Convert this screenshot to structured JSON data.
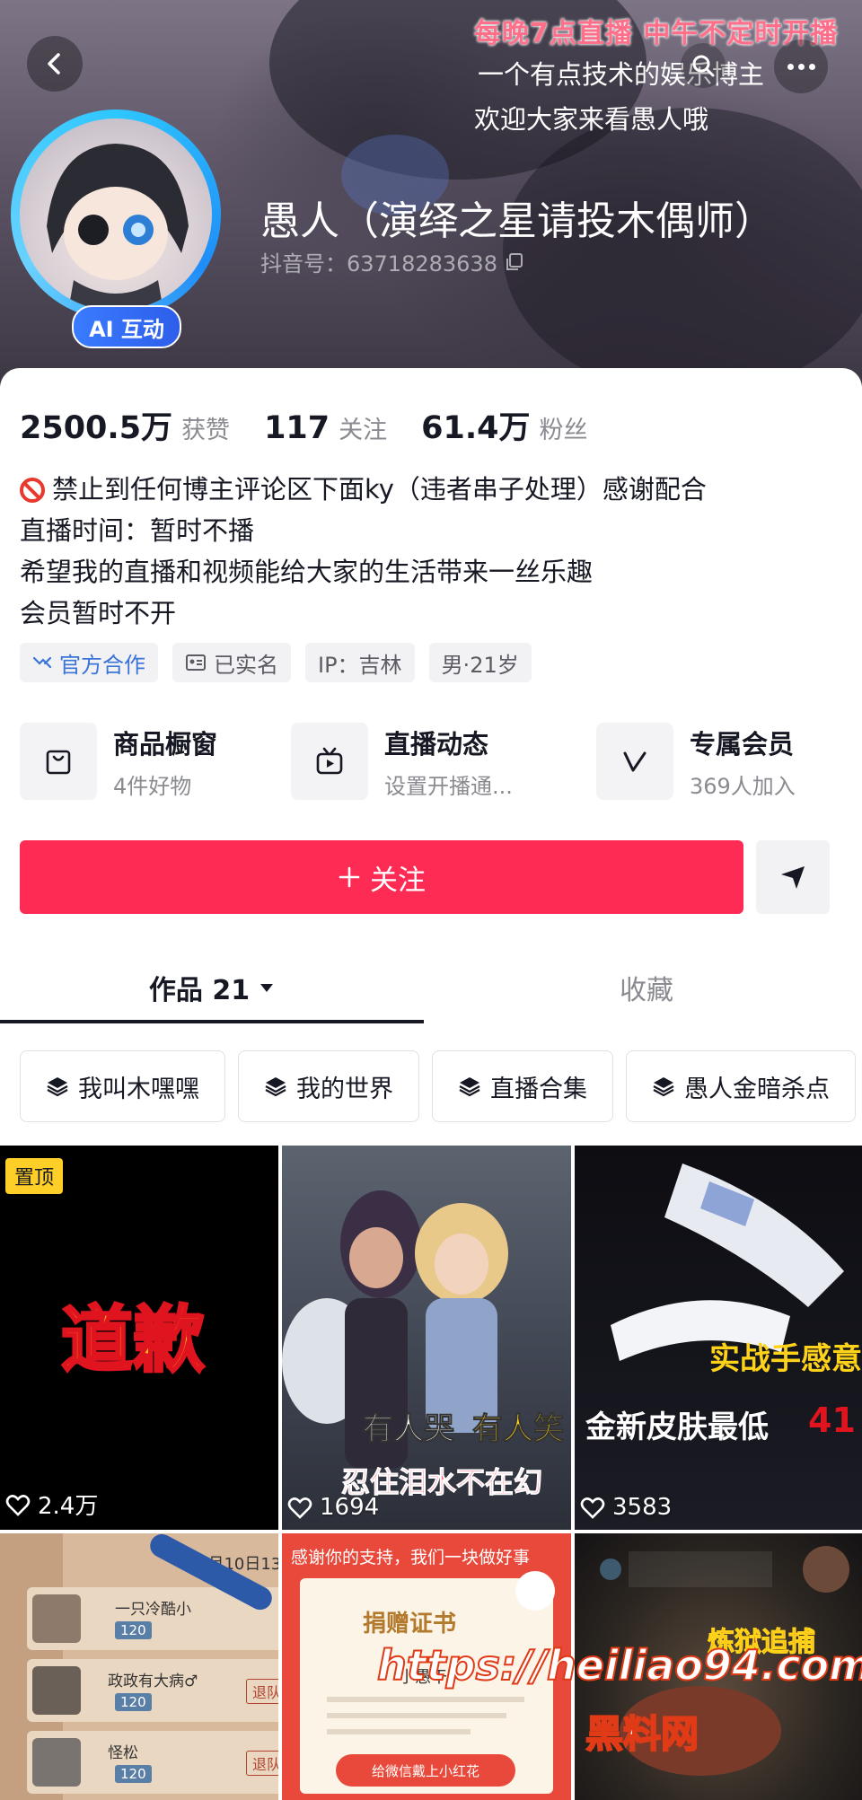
{
  "header": {
    "notice_line1": "每晚7点直播 中午不定时开播",
    "notice_line2": "一个有点技术的娱乐博主",
    "notice_line3": "欢迎大家来看愚人哦",
    "back_icon": "chevron-left-icon",
    "search_icon": "search-icon",
    "more_icon": "more-icon"
  },
  "profile": {
    "avatar_badge": "AI 互动",
    "name": "愚人（演绎之星请投木偶师）",
    "douyin_id": "抖音号：63718283638",
    "copy_icon": "copy-icon"
  },
  "stats": [
    {
      "num": "2500.5万",
      "label": "获赞"
    },
    {
      "num": "117",
      "label": "关注"
    },
    {
      "num": "61.4万",
      "label": "粉丝"
    }
  ],
  "bio": [
    "禁止到任何博主评论区下面ky（违者串子处理）感谢配合",
    "直播时间：暂时不播",
    "希望我的直播和视频能给大家的生活带来一丝乐趣",
    "会员暂时不开"
  ],
  "tags": [
    "官方合作",
    "已实名",
    "IP：吉林",
    "男·21岁"
  ],
  "services": [
    {
      "title": "商品橱窗",
      "sub": "4件好物",
      "icon": "shop-bag-icon"
    },
    {
      "title": "直播动态",
      "sub": "设置开播通...",
      "icon": "live-tv-icon"
    },
    {
      "title": "专属会员",
      "sub": "369人加入",
      "icon": "vip-v-icon"
    }
  ],
  "actions": {
    "follow_label": "关注",
    "share_icon": "share-arrow-icon"
  },
  "tabs": {
    "works": "作品 21",
    "favorites": "收藏"
  },
  "collections": [
    "我叫木嘿嘿",
    "我的世界",
    "直播合集",
    "愚人金暗杀点"
  ],
  "videos": [
    {
      "pinned": "置顶",
      "title": "道歉",
      "likes": "2.4万"
    },
    {
      "caption1": "有人哭",
      "caption2": "有人笑",
      "caption3": "忍住泪水不在幻",
      "likes": "1694"
    },
    {
      "caption1": "实战手感意",
      "caption2": "金新皮肤最低",
      "caption3": "41",
      "likes": "3583"
    },
    {
      "date": "3月10日13:",
      "rows": [
        "一只冷酷小",
        "政政有大病♂",
        "怪松"
      ],
      "level": "120",
      "btn": "退队"
    },
    {
      "header": "感谢你的支持，我们一块做好事",
      "cert": "捐赠证书",
      "name": "小愚干",
      "btn": "给微信戴上小红花"
    },
    {
      "caption": "炼狱追捕"
    }
  ],
  "watermark": {
    "url": "https://heiliao94.com",
    "site": "黑料网"
  }
}
